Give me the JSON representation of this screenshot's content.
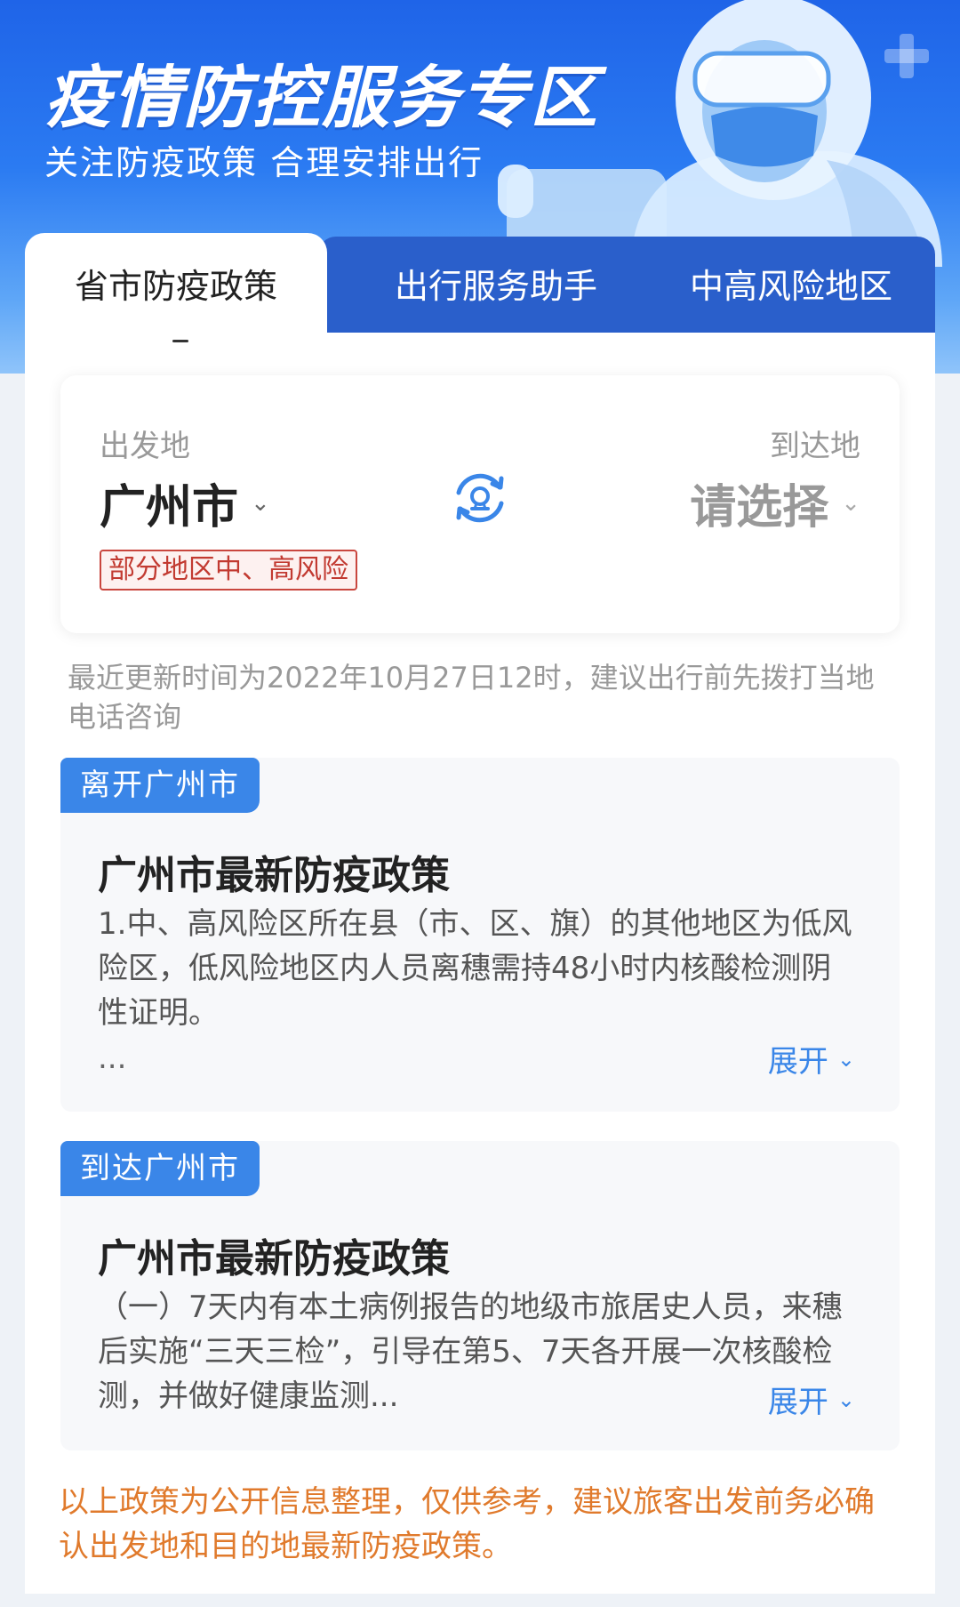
{
  "banner": {
    "title": "疫情防控服务专区",
    "subtitle": "关注防疫政策 合理安排出行"
  },
  "tabs": [
    {
      "label": "省市防疫政策",
      "active": true
    },
    {
      "label": "出行服务助手",
      "active": false
    },
    {
      "label": "中高风险地区",
      "active": false
    }
  ],
  "route": {
    "departure_label": "出发地",
    "departure_city": "广州市",
    "departure_risk_tag": "部分地区中、高风险",
    "arrival_label": "到达地",
    "arrival_city": "请选择",
    "swap_icon": "swap-icon"
  },
  "update_note": "最近更新时间为2022年10月27日12时，建议出行前先拨打当地电话咨询",
  "policies": [
    {
      "tag": "离开广州市",
      "title": "广州市最新防疫政策",
      "body": "1.中、高风险区所在县（市、区、旗）的其他地区为低风险区，低风险地区内人员离穗需持48小时内核酸检测阴性证明。",
      "ellipsis": "...",
      "expand_label": "展开"
    },
    {
      "tag": "到达广州市",
      "title": "广州市最新防疫政策",
      "body": "（一）7天内有本土病例报告的地级市旅居史人员，来穗后实施“三天三检”，引导在第5、7天各开展一次核酸检测，并做好健康监测...",
      "expand_label": "展开"
    }
  ],
  "disclaimer": "以上政策为公开信息整理，仅供参考，建议旅客出发前务必确认出发地和目的地最新防疫政策。",
  "colors": {
    "accent": "#3a86e8",
    "banner_top": "#1f64e8",
    "tab_inactive": "#2a5fcb",
    "risk_red": "#c23a31",
    "disclaimer_orange": "#e07a2c"
  }
}
